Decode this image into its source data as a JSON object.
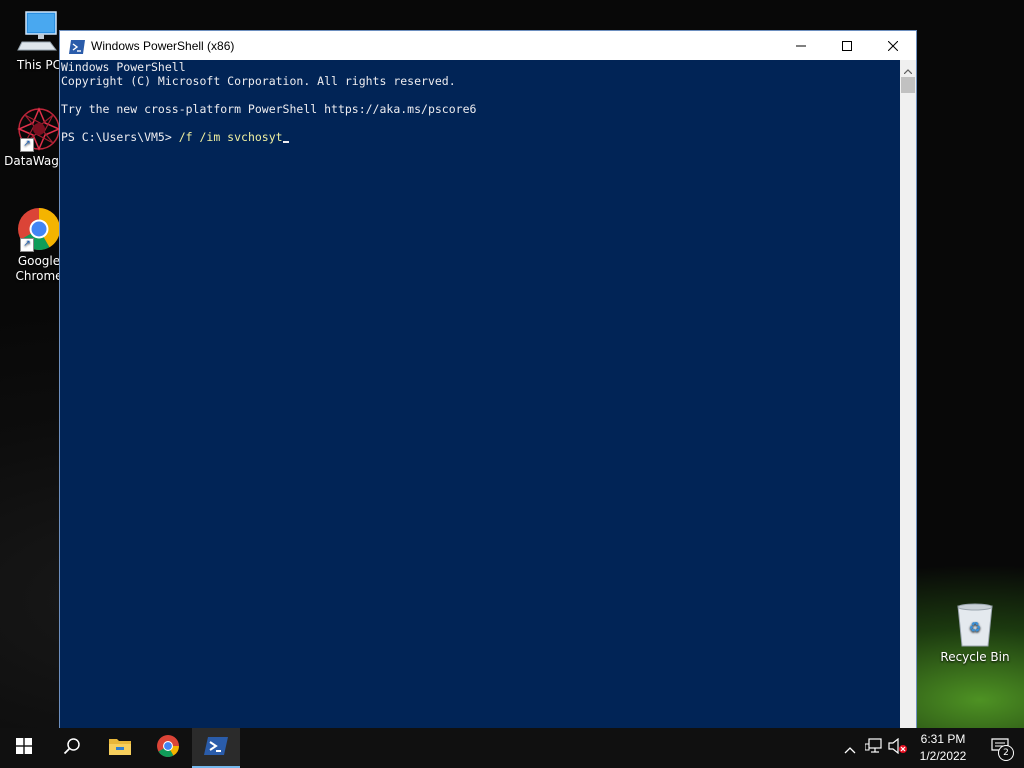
{
  "desktop": {
    "icons": [
      {
        "label": "This PC",
        "icon": "computer-icon"
      },
      {
        "label": "DataWagon",
        "icon": "datawagon-icon"
      },
      {
        "label": "Google Chrome",
        "icon": "chrome-icon"
      },
      {
        "label": "Recycle Bin",
        "icon": "recycle-bin-icon"
      }
    ]
  },
  "window": {
    "title": "Windows PowerShell (x86)",
    "controls": {
      "minimize": "minimize-icon",
      "maximize": "maximize-icon",
      "close": "close-icon"
    }
  },
  "console": {
    "lines": [
      "Windows PowerShell",
      "Copyright (C) Microsoft Corporation. All rights reserved.",
      "",
      "Try the new cross-platform PowerShell https://aka.ms/pscore6",
      ""
    ],
    "prompt": "PS C:\\Users\\VM5> ",
    "command": "/f /im svchosyt",
    "colors": {
      "background": "#012456",
      "text": "#eeedf0",
      "argument": "#f0f0a0"
    }
  },
  "taskbar": {
    "items": [
      {
        "name": "start",
        "icon": "windows-start-icon"
      },
      {
        "name": "search",
        "icon": "search-icon"
      },
      {
        "name": "file-explorer",
        "icon": "folder-icon"
      },
      {
        "name": "chrome",
        "icon": "chrome-icon"
      },
      {
        "name": "powershell",
        "icon": "powershell-icon",
        "active": true
      }
    ],
    "tray": {
      "time": "6:31 PM",
      "date": "1/2/2022",
      "notification_count": "2"
    }
  }
}
